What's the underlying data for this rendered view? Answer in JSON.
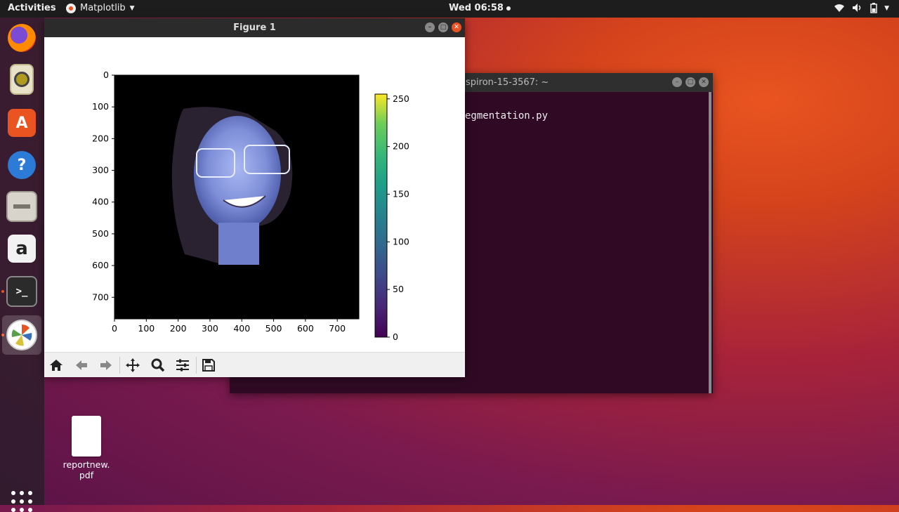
{
  "topbar": {
    "activities": "Activities",
    "app_menu": "Matplotlib",
    "clock": "Wed 06:58",
    "icons": [
      "wifi-icon",
      "volume-icon",
      "battery-icon",
      "chevron-down-icon"
    ]
  },
  "dock": {
    "items": [
      {
        "name": "firefox",
        "icon": "firefox-icon"
      },
      {
        "name": "rhythmbox",
        "icon": "speaker-icon"
      },
      {
        "name": "software",
        "icon": "software-store-icon"
      },
      {
        "name": "help",
        "icon": "help-icon"
      },
      {
        "name": "files",
        "icon": "file-cabinet-icon"
      },
      {
        "name": "amazon",
        "icon": "amazon-icon"
      },
      {
        "name": "terminal",
        "icon": "terminal-icon"
      },
      {
        "name": "matplotlib",
        "icon": "matplotlib-icon"
      }
    ]
  },
  "terminal": {
    "title": "spiron-15-3567: ~",
    "line": "egmentation.py"
  },
  "figure": {
    "title": "Figure 1"
  },
  "chart_data": {
    "type": "heatmap",
    "title": "",
    "xlabel": "",
    "ylabel": "",
    "x_ticks": [
      "0",
      "100",
      "200",
      "300",
      "400",
      "500",
      "600",
      "700"
    ],
    "y_ticks": [
      "0",
      "100",
      "200",
      "300",
      "400",
      "500",
      "600",
      "700"
    ],
    "xlim": [
      0,
      768
    ],
    "ylim": [
      768,
      0
    ],
    "colorbar": {
      "colormap": "viridis",
      "range": [
        0,
        255
      ],
      "ticks": [
        "0",
        "50",
        "100",
        "150",
        "200",
        "250"
      ]
    },
    "content": "segmented face image on black background (imshow)"
  },
  "toolbar": {
    "tools": [
      "home-icon",
      "back-icon",
      "forward-icon",
      "pan-icon",
      "zoom-icon",
      "configure-subplots-icon",
      "save-icon"
    ]
  },
  "desktop": {
    "file_label_1": "reportnew.",
    "file_label_2": "pdf"
  },
  "colors": {
    "accent": "#e95420",
    "terminal_bg": "#300a24"
  }
}
